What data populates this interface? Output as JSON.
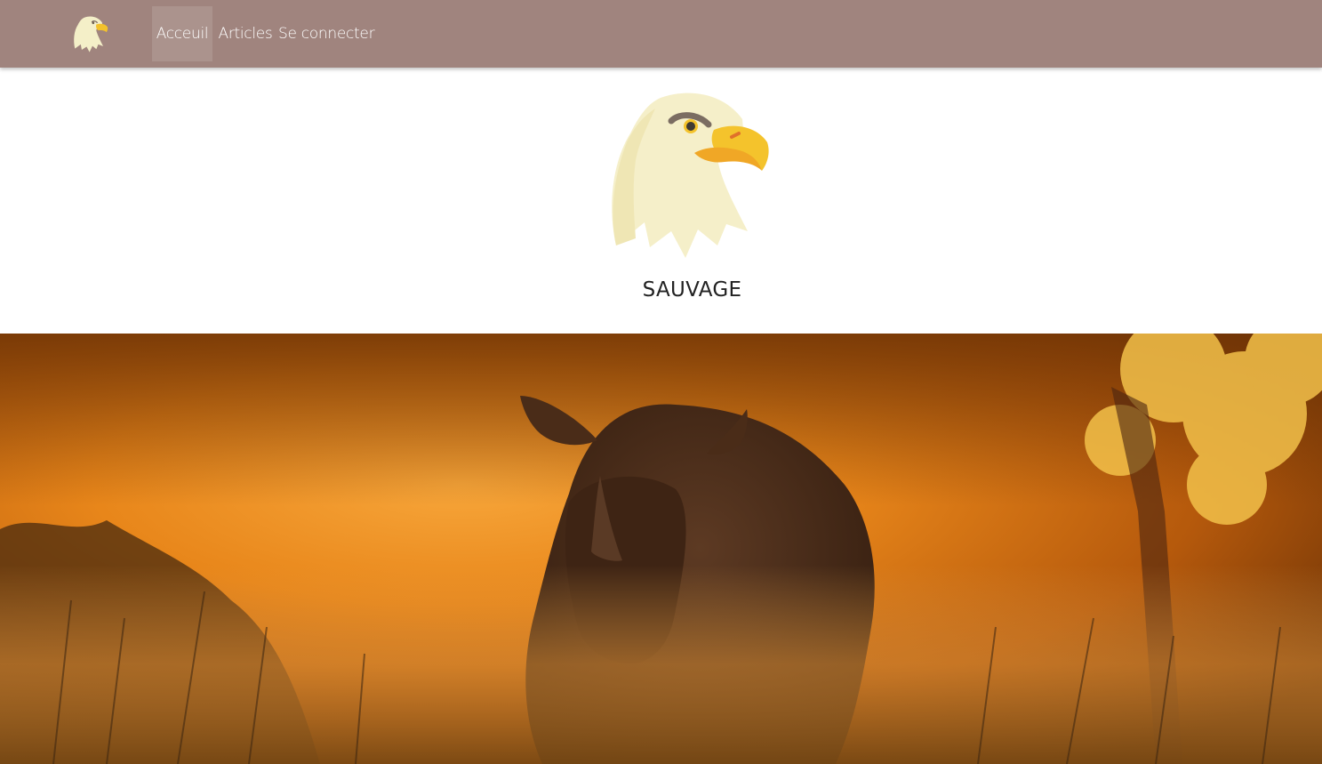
{
  "navbar": {
    "logo_icon": "eagle-head-icon",
    "items": [
      {
        "label": "Acceuil",
        "active": true
      },
      {
        "label": "Articles",
        "active": false
      },
      {
        "label": "Se connecter",
        "active": false
      }
    ],
    "background": "#a0847e"
  },
  "hero": {
    "logo_icon": "eagle-head-icon",
    "title": "SAUVAGE"
  },
  "banner": {
    "image": "rhino-savanna-sunset-photo",
    "accent": "#e08a14"
  }
}
